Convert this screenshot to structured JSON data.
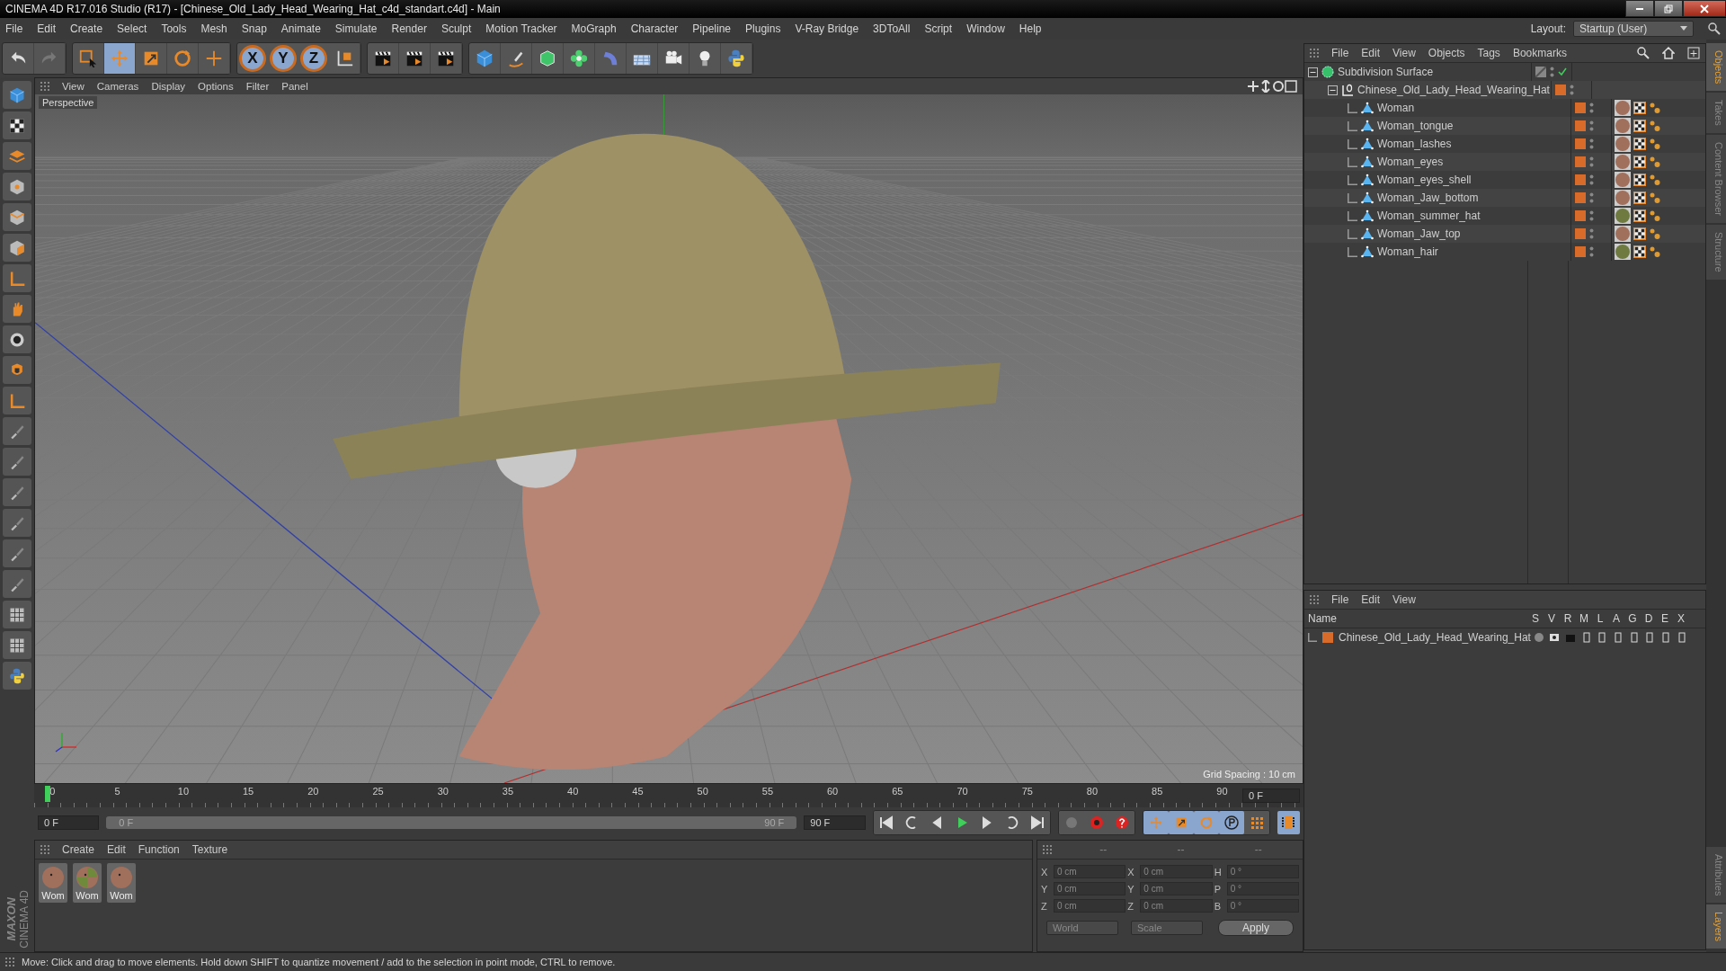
{
  "window": {
    "title": "CINEMA 4D R17.016 Studio (R17) - [Chinese_Old_Lady_Head_Wearing_Hat_c4d_standart.c4d] - Main"
  },
  "menu_bar": [
    "File",
    "Edit",
    "Create",
    "Select",
    "Tools",
    "Mesh",
    "Snap",
    "Animate",
    "Simulate",
    "Render",
    "Sculpt",
    "Motion Tracker",
    "MoGraph",
    "Character",
    "Pipeline",
    "Plugins",
    "V-Ray Bridge",
    "3DToAll",
    "Script",
    "Window",
    "Help"
  ],
  "layout": {
    "label": "Layout:",
    "value": "Startup (User)"
  },
  "tools": [
    {
      "kind": "select",
      "selected": false
    },
    {
      "kind": "move",
      "selected": true
    },
    {
      "kind": "scale",
      "selected": false
    },
    {
      "kind": "rotate",
      "selected": false
    },
    {
      "kind": "transform",
      "selected": false
    }
  ],
  "axis_lock": [
    {
      "label": "X",
      "selected": true
    },
    {
      "label": "Y",
      "selected": true
    },
    {
      "label": "Z",
      "selected": true
    }
  ],
  "viewport": {
    "menu": [
      "View",
      "Cameras",
      "Display",
      "Options",
      "Filter",
      "Panel"
    ],
    "camera": "Perspective",
    "grid_spacing": "Grid Spacing : 10 cm"
  },
  "timeline": {
    "ticks": [
      "0",
      "5",
      "10",
      "15",
      "20",
      "25",
      "30",
      "35",
      "40",
      "45",
      "50",
      "55",
      "60",
      "65",
      "70",
      "75",
      "80",
      "85",
      "90"
    ],
    "level": 0,
    "current_frame": "0 F",
    "start_frame": "0 F",
    "range": {
      "start": "0 F",
      "end": "90 F",
      "level": 1
    },
    "end_frame": "90 F"
  },
  "material_manager": {
    "menu": [
      "Create",
      "Edit",
      "Function",
      "Texture"
    ],
    "materials": [
      {
        "name": "Wom",
        "kind": "skin"
      },
      {
        "name": "Wom",
        "kind": "hat"
      },
      {
        "name": "Wom",
        "kind": "skin"
      }
    ]
  },
  "coordinates": {
    "headers": [
      "--",
      "--",
      "--"
    ],
    "rows": [
      {
        "axis": "X",
        "position": "0 cm",
        "size_axis": "X",
        "size": "0 cm",
        "rotation_axis": "H",
        "rotation": "0 °"
      },
      {
        "axis": "Y",
        "position": "0 cm",
        "size_axis": "Y",
        "size": "0 cm",
        "rotation_axis": "P",
        "rotation": "0 °"
      },
      {
        "axis": "Z",
        "position": "0 cm",
        "size_axis": "Z",
        "size": "0 cm",
        "rotation_axis": "B",
        "rotation": "0 °"
      }
    ],
    "space": "World",
    "mode": "Scale",
    "apply": "Apply"
  },
  "object_manager": {
    "menu": [
      "File",
      "Edit",
      "View",
      "Objects",
      "Tags",
      "Bookmarks"
    ],
    "objects": [
      {
        "name": "Subdivision Surface",
        "kind": "generator",
        "expanded": true,
        "enabled": true,
        "children": [
          {
            "name": "Chinese_Old_Lady_Head_Wearing_Hat",
            "kind": "null",
            "expanded": true,
            "children": [
              {
                "name": "Woman",
                "kind": "polygon",
                "color": "#a0705c"
              },
              {
                "name": "Woman_tongue",
                "kind": "polygon",
                "color": "#a0705c"
              },
              {
                "name": "Woman_lashes",
                "kind": "polygon",
                "color": "#a0705c"
              },
              {
                "name": "Woman_eyes",
                "kind": "polygon",
                "color": "#a0705c"
              },
              {
                "name": "Woman_eyes_shell",
                "kind": "polygon",
                "color": "#a0705c"
              },
              {
                "name": "Woman_Jaw_bottom",
                "kind": "polygon",
                "color": "#a0705c"
              },
              {
                "name": "Woman_summer_hat",
                "kind": "polygon",
                "color": "#6f7a40"
              },
              {
                "name": "Woman_Jaw_top",
                "kind": "polygon",
                "color": "#a0705c"
              },
              {
                "name": "Woman_hair",
                "kind": "polygon",
                "color": "#6f7a40"
              }
            ]
          }
        ]
      }
    ]
  },
  "layer_manager": {
    "menu": [
      "File",
      "Edit",
      "View"
    ],
    "columns": [
      "Name",
      "S",
      "V",
      "R",
      "M",
      "L",
      "A",
      "G",
      "D",
      "E",
      "X"
    ],
    "layers": [
      {
        "name": "Chinese_Old_Lady_Head_Wearing_Hat"
      }
    ]
  },
  "side_tabs": [
    {
      "label": "Objects",
      "selected": true
    },
    {
      "label": "Takes",
      "selected": false
    },
    {
      "label": "Content Browser",
      "selected": false
    },
    {
      "label": "Structure",
      "selected": false
    }
  ],
  "side_tabs_lower": [
    {
      "label": "Attributes",
      "selected": false
    },
    {
      "label": "Layers",
      "selected": true
    }
  ],
  "brand": {
    "maker": "MAXON",
    "product": "CINEMA 4D"
  },
  "status_bar": "Move: Click and drag to move elements. Hold down SHIFT to quantize movement / add to the selection in point mode, CTRL to remove."
}
